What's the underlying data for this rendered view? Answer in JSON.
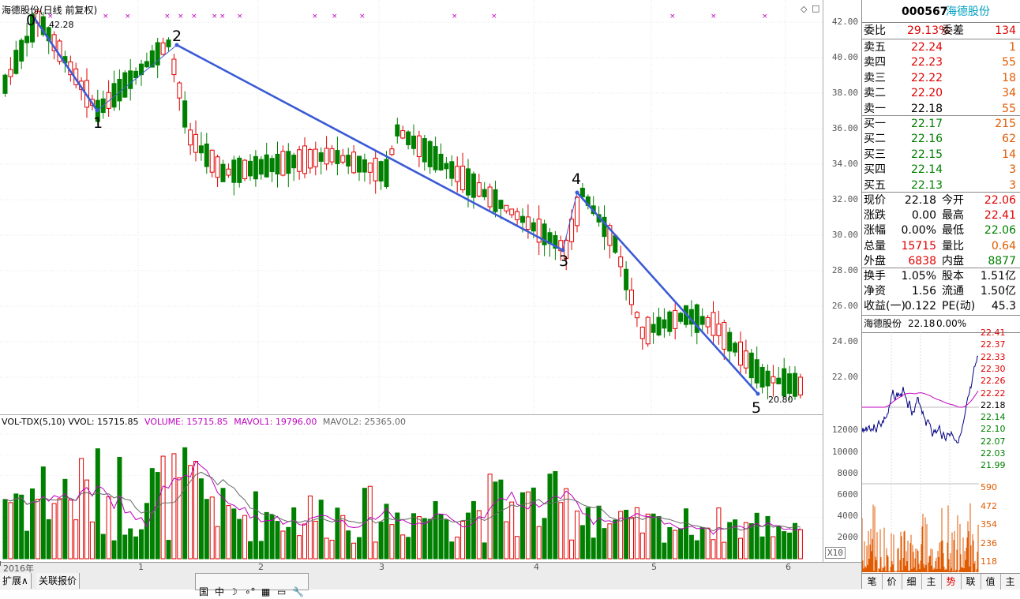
{
  "chart_header": {
    "title": "海德股份(日线 前复权)",
    "high_marker": "42.28",
    "low_marker": "20.80"
  },
  "wave_labels": [
    "0",
    "1",
    "2",
    "3",
    "4",
    "5"
  ],
  "price_axis": [
    "42.00",
    "40.00",
    "38.00",
    "36.00",
    "34.00",
    "32.00",
    "30.00",
    "28.00",
    "26.00",
    "24.00",
    "22.00"
  ],
  "volume_header": {
    "name": "VOL-TDX(5,10)",
    "vvol": "VVOL: 15715.85",
    "volume": "VOLUME: 15715.85",
    "mavol1": "MAVOL1: 19796.00",
    "mavol2": "MAVOL2: 25365.00"
  },
  "volume_axis": [
    "12000",
    "10000",
    "8000",
    "6000",
    "4000",
    "2000"
  ],
  "volume_unit": "X10",
  "x_axis": {
    "labels": [
      "2016年",
      "1",
      "2",
      "3",
      "4",
      "5",
      "6"
    ],
    "period": "日线"
  },
  "bottom_tabs": [
    "扩展∧",
    "关联报价"
  ],
  "toolbar_icons": [
    "国",
    "中",
    "☽",
    "∘°",
    "▦",
    "▭",
    "🔧"
  ],
  "quote_panel": {
    "code": "000567",
    "name": "海德股份",
    "weibi_label": "委比",
    "weibi_value": "29.13%",
    "weicha_label": "委差",
    "weicha_value": "134",
    "asks": [
      {
        "label": "卖五",
        "price": "22.24",
        "vol": "1"
      },
      {
        "label": "卖四",
        "price": "22.23",
        "vol": "55"
      },
      {
        "label": "卖三",
        "price": "22.22",
        "vol": "18"
      },
      {
        "label": "卖二",
        "price": "22.20",
        "vol": "34"
      },
      {
        "label": "卖一",
        "price": "22.18",
        "vol": "55"
      }
    ],
    "bids": [
      {
        "label": "买一",
        "price": "22.17",
        "vol": "215"
      },
      {
        "label": "买二",
        "price": "22.16",
        "vol": "62"
      },
      {
        "label": "买三",
        "price": "22.15",
        "vol": "14"
      },
      {
        "label": "买四",
        "price": "22.14",
        "vol": "3"
      },
      {
        "label": "买五",
        "price": "22.13",
        "vol": "3"
      }
    ],
    "stats": [
      {
        "l1": "现价",
        "v1": "22.18",
        "l2": "今开",
        "v2": "22.06"
      },
      {
        "l1": "涨跌",
        "v1": "0.00",
        "l2": "最高",
        "v2": "22.41"
      },
      {
        "l1": "涨幅",
        "v1": "0.00%",
        "l2": "最低",
        "v2": "22.06"
      },
      {
        "l1": "总量",
        "v1": "15715",
        "l2": "量比",
        "v2": "0.64"
      },
      {
        "l1": "外盘",
        "v1": "6838",
        "l2": "内盘",
        "v2": "8877"
      }
    ],
    "stats2": [
      {
        "l1": "换手",
        "v1": "1.05%",
        "l2": "股本",
        "v2": "1.51亿"
      },
      {
        "l1": "净资",
        "v1": "1.56",
        "l2": "流通",
        "v2": "1.50亿"
      },
      {
        "l1": "收益(一)",
        "v1": "0.122",
        "l2": "PE(动)",
        "v2": "45.3"
      }
    ],
    "mini_title": "海德股份",
    "mini_price": "22.18",
    "mini_pct": "0.00%",
    "mini_price_axis": [
      "22.41",
      "22.37",
      "22.33",
      "22.30",
      "22.26",
      "22.22",
      "22.18",
      "22.14",
      "22.10",
      "22.07",
      "22.03",
      "21.99"
    ],
    "mini_vol_axis": [
      "590",
      "472",
      "354",
      "236",
      "118"
    ],
    "tabs": [
      "笔",
      "价",
      "细",
      "势",
      "联",
      "值",
      "主"
    ],
    "active_tab": "势"
  },
  "chart_data": {
    "type": "candlestick",
    "title": "海德股份(日线 前复权)",
    "ylim": [
      22.0,
      42.0
    ],
    "high": 42.28,
    "low": 20.8,
    "waves": [
      {
        "label": "0",
        "price": 42.28
      },
      {
        "label": "1",
        "price": 37.0
      },
      {
        "label": "2",
        "price": 40.8
      },
      {
        "label": "3",
        "price": 29.2
      },
      {
        "label": "4",
        "price": 32.4
      },
      {
        "label": "5",
        "price": 20.8
      }
    ],
    "volume_ylim": [
      0,
      12000
    ]
  }
}
